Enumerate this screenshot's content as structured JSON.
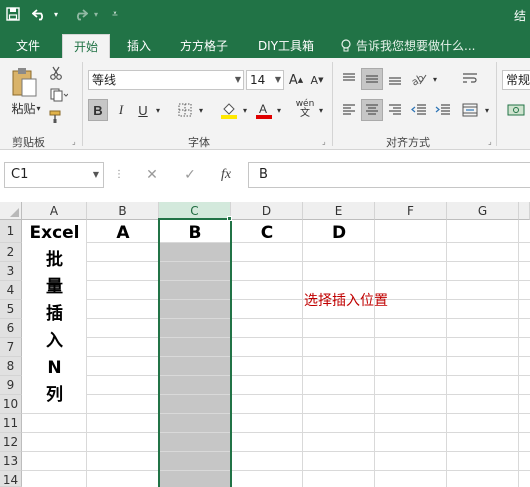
{
  "titlebar": {
    "save_icon": "save-icon",
    "undo_icon": "undo-icon",
    "redo_icon": "redo-icon",
    "customize_icon": "customize-quick-access-icon",
    "title_fragment": "结"
  },
  "tabs": [
    {
      "label": "文件",
      "active": false
    },
    {
      "label": "开始",
      "active": true
    },
    {
      "label": "插入",
      "active": false
    },
    {
      "label": "方方格子",
      "active": false
    },
    {
      "label": "DIY工具箱",
      "active": false
    }
  ],
  "tell_me": "告诉我您想要做什么...",
  "ribbon": {
    "clipboard": {
      "paste_label": "粘贴",
      "group_label": "剪贴板"
    },
    "font": {
      "font_name": "等线",
      "font_size": "14",
      "bold": "B",
      "italic": "I",
      "underline": "U",
      "wen": "wén",
      "group_label": "字体"
    },
    "alignment": {
      "group_label": "对齐方式"
    },
    "number": {
      "format_label": "常规"
    }
  },
  "formula_bar": {
    "name_box": "C1",
    "cancel": "✕",
    "enter": "✓",
    "fx": "fx",
    "content": "B"
  },
  "grid": {
    "columns": [
      "A",
      "B",
      "C",
      "D",
      "E",
      "F",
      "G"
    ],
    "rows": [
      "1",
      "2",
      "3",
      "4",
      "5",
      "6",
      "7",
      "8",
      "9",
      "10",
      "11",
      "12",
      "13",
      "14"
    ],
    "selected_column": "C",
    "row1_values": {
      "B": "A",
      "C": "B",
      "D": "C",
      "E": "D"
    },
    "column_a_text": [
      "Excel",
      "批",
      "量",
      "插",
      "入",
      "N",
      "列"
    ],
    "note": "选择插入位置"
  },
  "colors": {
    "accent": "#217346",
    "selection": "#c6c6c6",
    "note": "#c00000"
  }
}
